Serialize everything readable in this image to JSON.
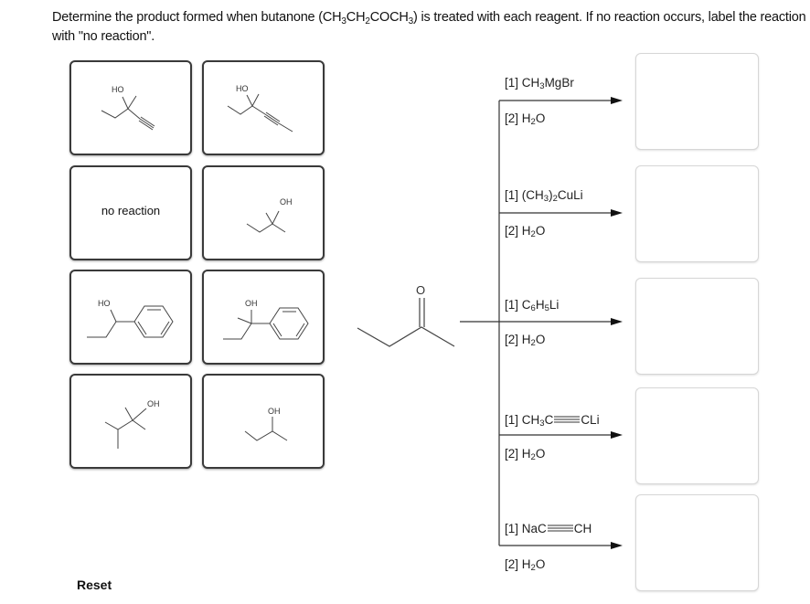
{
  "prompt": {
    "part1": "Determine the product formed when butanone (CH",
    "sub1": "3",
    "part2": "CH",
    "sub2": "2",
    "part3": "COCH",
    "sub3": "3",
    "part4": ") is treated with each reagent.  If no reaction occurs, label the reaction with \"no reaction\"."
  },
  "tiles": [
    {
      "id": "tile-3-methyl-1-pentyn-3-ol",
      "label": "HO"
    },
    {
      "id": "tile-3-methyl-4-hexyn-3-ol",
      "label": "HO"
    },
    {
      "id": "tile-no-reaction",
      "text": "no reaction"
    },
    {
      "id": "tile-2-methyl-2-butanol",
      "label": "OH"
    },
    {
      "id": "tile-1-phenyl-1-propanol",
      "label": "HO"
    },
    {
      "id": "tile-2-phenyl-2-butanol",
      "label": "OH"
    },
    {
      "id": "tile-2-3-dimethyl-2-butanol",
      "label": "OH"
    },
    {
      "id": "tile-2-butanol",
      "label": "OH"
    }
  ],
  "starting_material": {
    "name": "butanone",
    "o_label": "O"
  },
  "reactions": [
    {
      "step1": {
        "prefix": "[1] CH",
        "sub": "3",
        "suffix": "MgBr"
      },
      "step2": {
        "prefix": "[2] H",
        "sub": "2",
        "suffix": "O"
      }
    },
    {
      "step1": {
        "prefix": "[1] (CH",
        "sub": "3",
        "suffix": ")",
        "sub2": "2",
        "suffix2": "CuLi"
      },
      "step2": {
        "prefix": "[2] H",
        "sub": "2",
        "suffix": "O"
      }
    },
    {
      "step1": {
        "prefix": "[1] C",
        "sub": "6",
        "suffix": "H",
        "sub2": "5",
        "suffix2": "Li"
      },
      "step2": {
        "prefix": "[2] H",
        "sub": "2",
        "suffix": "O"
      }
    },
    {
      "step1": {
        "prefix": "[1] CH",
        "sub": "3",
        "suffix": "C",
        "suffix2": "CLi"
      },
      "step2": {
        "prefix": "[2] H",
        "sub": "2",
        "suffix": "O"
      }
    },
    {
      "step1": {
        "prefix": "[1] NaC",
        "suffix2": "CH"
      },
      "step2": {
        "prefix": "[2] H",
        "sub": "2",
        "suffix": "O"
      }
    }
  ],
  "drop_targets": [
    "answer-1",
    "answer-2",
    "answer-3",
    "answer-4",
    "answer-5"
  ],
  "reset_label": "Reset"
}
